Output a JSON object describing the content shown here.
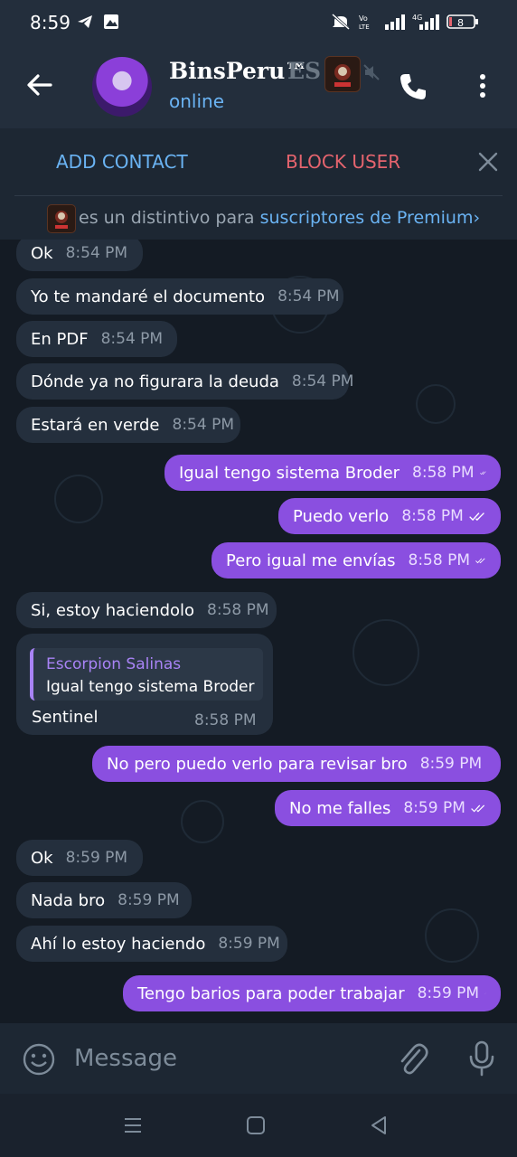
{
  "status_bar": {
    "time": "8:59",
    "battery": "8",
    "network_label": "4G",
    "volte_label": "Vo LTE"
  },
  "header": {
    "title": "BinsPeru™",
    "title_overflow": "ES",
    "status": "online"
  },
  "actions": {
    "add_contact": "ADD CONTACT",
    "block_user": "BLOCK USER"
  },
  "premium_banner": {
    "text": "es un distintivo para ",
    "link": "suscriptores de Premium",
    "chevron": "›"
  },
  "messages": [
    {
      "text": "Ok",
      "time": "8:54 PM",
      "dir": "in"
    },
    {
      "text": "Yo te mandaré el documento",
      "time": "8:54 PM",
      "dir": "in"
    },
    {
      "text": "En PDF",
      "time": "8:54 PM",
      "dir": "in"
    },
    {
      "text": "Dónde ya no figurara la deuda",
      "time": "8:54 PM",
      "dir": "in"
    },
    {
      "text": "Estará en verde",
      "time": "8:54 PM",
      "dir": "in"
    },
    {
      "text": "Igual tengo sistema Broder",
      "time": "8:58 PM",
      "dir": "out",
      "status": "read"
    },
    {
      "text": "Puedo verlo",
      "time": "8:58 PM",
      "dir": "out",
      "status": "read"
    },
    {
      "text": "Pero igual me envías",
      "time": "8:58 PM",
      "dir": "out",
      "status": "read"
    },
    {
      "text": "Si, estoy haciendolo",
      "time": "8:58 PM",
      "dir": "in"
    },
    {
      "text": "No pero puedo verlo para revisar bro",
      "time": "8:59 PM",
      "dir": "out",
      "status": "read"
    },
    {
      "text": "No me falles",
      "time": "8:59 PM",
      "dir": "out",
      "status": "read"
    },
    {
      "text": "Ok",
      "time": "8:59 PM",
      "dir": "in"
    },
    {
      "text": "Nada bro",
      "time": "8:59 PM",
      "dir": "in"
    },
    {
      "text": "Ahí lo estoy haciendo",
      "time": "8:59 PM",
      "dir": "in"
    },
    {
      "text": "Tengo barios para poder trabajar",
      "time": "8:59 PM",
      "dir": "out",
      "status": "sent"
    }
  ],
  "reply_message": {
    "quote_name": "Escorpion Salinas",
    "quote_text": "Igual tengo sistema Broder",
    "text": "Sentinel",
    "time": "8:58 PM"
  },
  "composer": {
    "placeholder": "Message"
  },
  "icons": [
    "back-arrow-icon",
    "mute-icon",
    "phone-icon",
    "more-vert-icon",
    "close-icon",
    "emoji-icon",
    "attach-icon",
    "mic-icon"
  ]
}
